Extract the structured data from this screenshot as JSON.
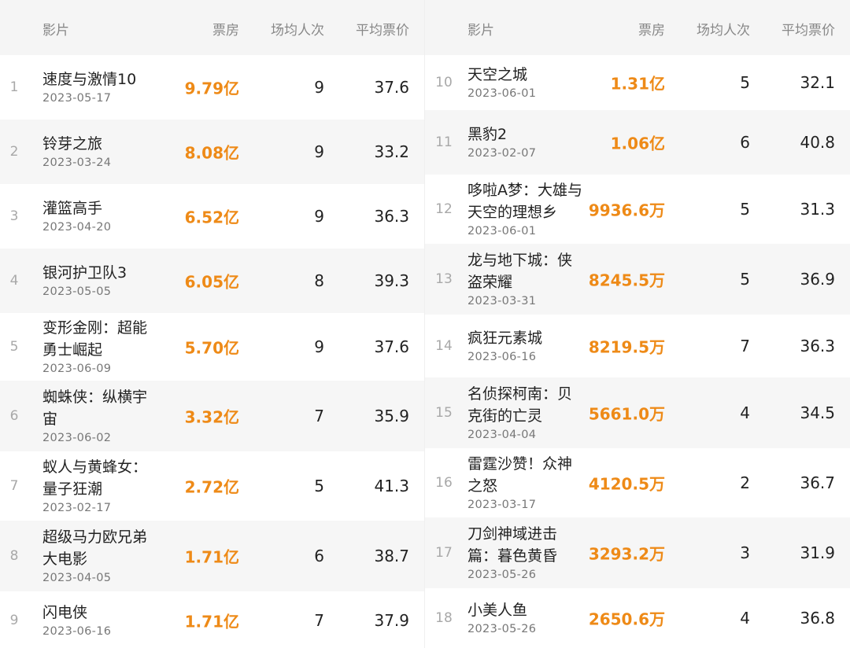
{
  "columns": {
    "film": "影片",
    "box_office": "票房",
    "attendance": "场均人次",
    "avg_price": "平均票价"
  },
  "rows": [
    {
      "rank": "1",
      "name": "速度与激情10",
      "date": "2023-05-17",
      "box": "9.79亿",
      "att": "9",
      "price": "37.6"
    },
    {
      "rank": "2",
      "name": "铃芽之旅",
      "date": "2023-03-24",
      "box": "8.08亿",
      "att": "9",
      "price": "33.2"
    },
    {
      "rank": "3",
      "name": "灌篮高手",
      "date": "2023-04-20",
      "box": "6.52亿",
      "att": "9",
      "price": "36.3"
    },
    {
      "rank": "4",
      "name": "银河护卫队3",
      "date": "2023-05-05",
      "box": "6.05亿",
      "att": "8",
      "price": "39.3"
    },
    {
      "rank": "5",
      "name": "变形金刚：超能勇士崛起",
      "date": "2023-06-09",
      "box": "5.70亿",
      "att": "9",
      "price": "37.6"
    },
    {
      "rank": "6",
      "name": "蜘蛛侠：纵横宇宙",
      "date": "2023-06-02",
      "box": "3.32亿",
      "att": "7",
      "price": "35.9"
    },
    {
      "rank": "7",
      "name": "蚁人与黄蜂女：量子狂潮",
      "date": "2023-02-17",
      "box": "2.72亿",
      "att": "5",
      "price": "41.3"
    },
    {
      "rank": "8",
      "name": "超级马力欧兄弟大电影",
      "date": "2023-04-05",
      "box": "1.71亿",
      "att": "6",
      "price": "38.7"
    },
    {
      "rank": "9",
      "name": "闪电侠",
      "date": "2023-06-16",
      "box": "1.71亿",
      "att": "7",
      "price": "37.9"
    },
    {
      "rank": "10",
      "name": "天空之城",
      "date": "2023-06-01",
      "box": "1.31亿",
      "att": "5",
      "price": "32.1"
    },
    {
      "rank": "11",
      "name": "黑豹2",
      "date": "2023-02-07",
      "box": "1.06亿",
      "att": "6",
      "price": "40.8"
    },
    {
      "rank": "12",
      "name": "哆啦A梦：大雄与天空的理想乡",
      "date": "2023-06-01",
      "box": "9936.6万",
      "att": "5",
      "price": "31.3"
    },
    {
      "rank": "13",
      "name": "龙与地下城：侠盗荣耀",
      "date": "2023-03-31",
      "box": "8245.5万",
      "att": "5",
      "price": "36.9"
    },
    {
      "rank": "14",
      "name": "疯狂元素城",
      "date": "2023-06-16",
      "box": "8219.5万",
      "att": "7",
      "price": "36.3"
    },
    {
      "rank": "15",
      "name": "名侦探柯南：贝克街的亡灵",
      "date": "2023-04-04",
      "box": "5661.0万",
      "att": "4",
      "price": "34.5"
    },
    {
      "rank": "16",
      "name": "雷霆沙赞！众神之怒",
      "date": "2023-03-17",
      "box": "4120.5万",
      "att": "2",
      "price": "36.7"
    },
    {
      "rank": "17",
      "name": "刀剑神域进击篇：暮色黄昏",
      "date": "2023-05-26",
      "box": "3293.2万",
      "att": "3",
      "price": "31.9"
    },
    {
      "rank": "18",
      "name": "小美人鱼",
      "date": "2023-05-26",
      "box": "2650.6万",
      "att": "4",
      "price": "36.8"
    }
  ],
  "colors": {
    "box_office": "#ee8a17",
    "header_bg": "#f5f5f5",
    "stripe_bg": "#f6f6f6"
  }
}
